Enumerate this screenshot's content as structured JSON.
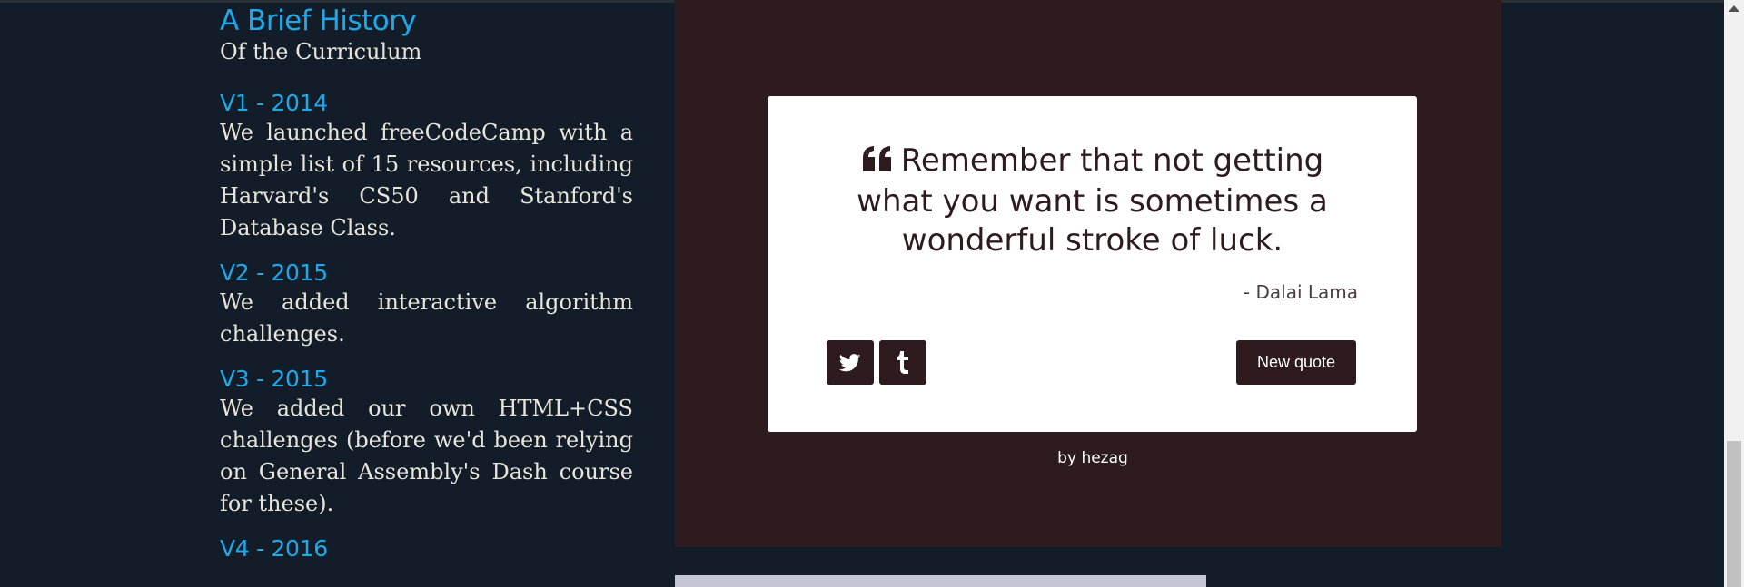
{
  "history": {
    "title": "A Brief History",
    "subtitle": "Of the Curriculum",
    "entries": [
      {
        "heading": "V1 - 2014",
        "text": "We launched freeCodeCamp with a simple list of 15 resources, including Harvard's CS50 and Stanford's Database Class."
      },
      {
        "heading": "V2 - 2015",
        "text": "We added interactive algorithm challenges."
      },
      {
        "heading": "V3 - 2015",
        "text": "We added our own HTML+CSS challenges (before we'd been relying on General Assembly's Dash course for these)."
      },
      {
        "heading": "V4 - 2016",
        "text": ""
      }
    ]
  },
  "quote_machine": {
    "quote_icon": "quote-left-icon",
    "quote": "Remember that not getting what you want is sometimes a wonderful stroke of luck.",
    "author": "- Dalai Lama",
    "twitter_icon": "twitter-icon",
    "tumblr_icon": "tumblr-icon",
    "new_quote_label": "New quote",
    "byline_prefix": "by",
    "byline_link": "hezag"
  },
  "colors": {
    "background": "#121d29",
    "accent": "#1fa8e8",
    "panel": "#2e1b1e",
    "card": "#ffffff"
  }
}
